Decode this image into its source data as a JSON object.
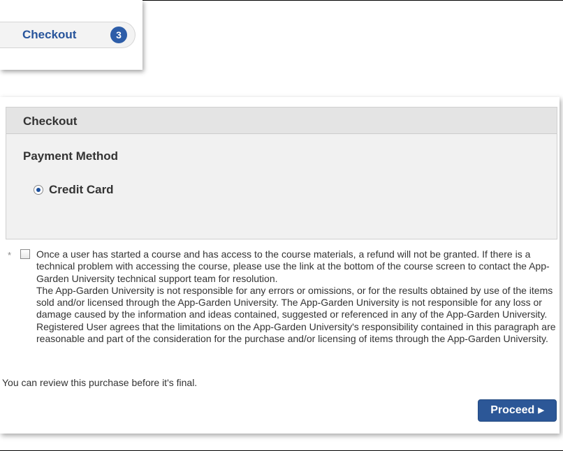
{
  "nav_tab": {
    "label": "Checkout",
    "step": "3"
  },
  "checkout": {
    "title": "Checkout",
    "payment_heading": "Payment Method",
    "payment_option": "Credit Card",
    "payment_selected": true,
    "terms_marker": "*",
    "terms_checked": false,
    "terms_paragraph_1": "Once a user has started a course and has access to the course materials, a refund will not be granted. If there is a technical problem with accessing the course, please use the link at the bottom of the course screen to contact the App-Garden University technical support team for resolution.",
    "terms_paragraph_2": "The App-Garden University is not responsible for any errors or omissions, or for the results obtained by use of the items sold and/or licensed through the App-Garden University. The App-Garden University is not responsible for any loss or damage caused by the information and ideas contained, suggested or referenced in any of the App-Garden University. Registered User agrees that the limitations on the App-Garden University's responsibility contained in this paragraph are reasonable and part of the consideration for the purchase and/or licensing of items through the App-Garden University.",
    "review_note": "You can review this purchase before it's final.",
    "proceed_label": "Proceed",
    "proceed_icon": "caret-right-icon"
  },
  "colors": {
    "link_blue": "#27549b",
    "badge_blue": "#2d5da8",
    "button_blue": "#2c5797"
  }
}
